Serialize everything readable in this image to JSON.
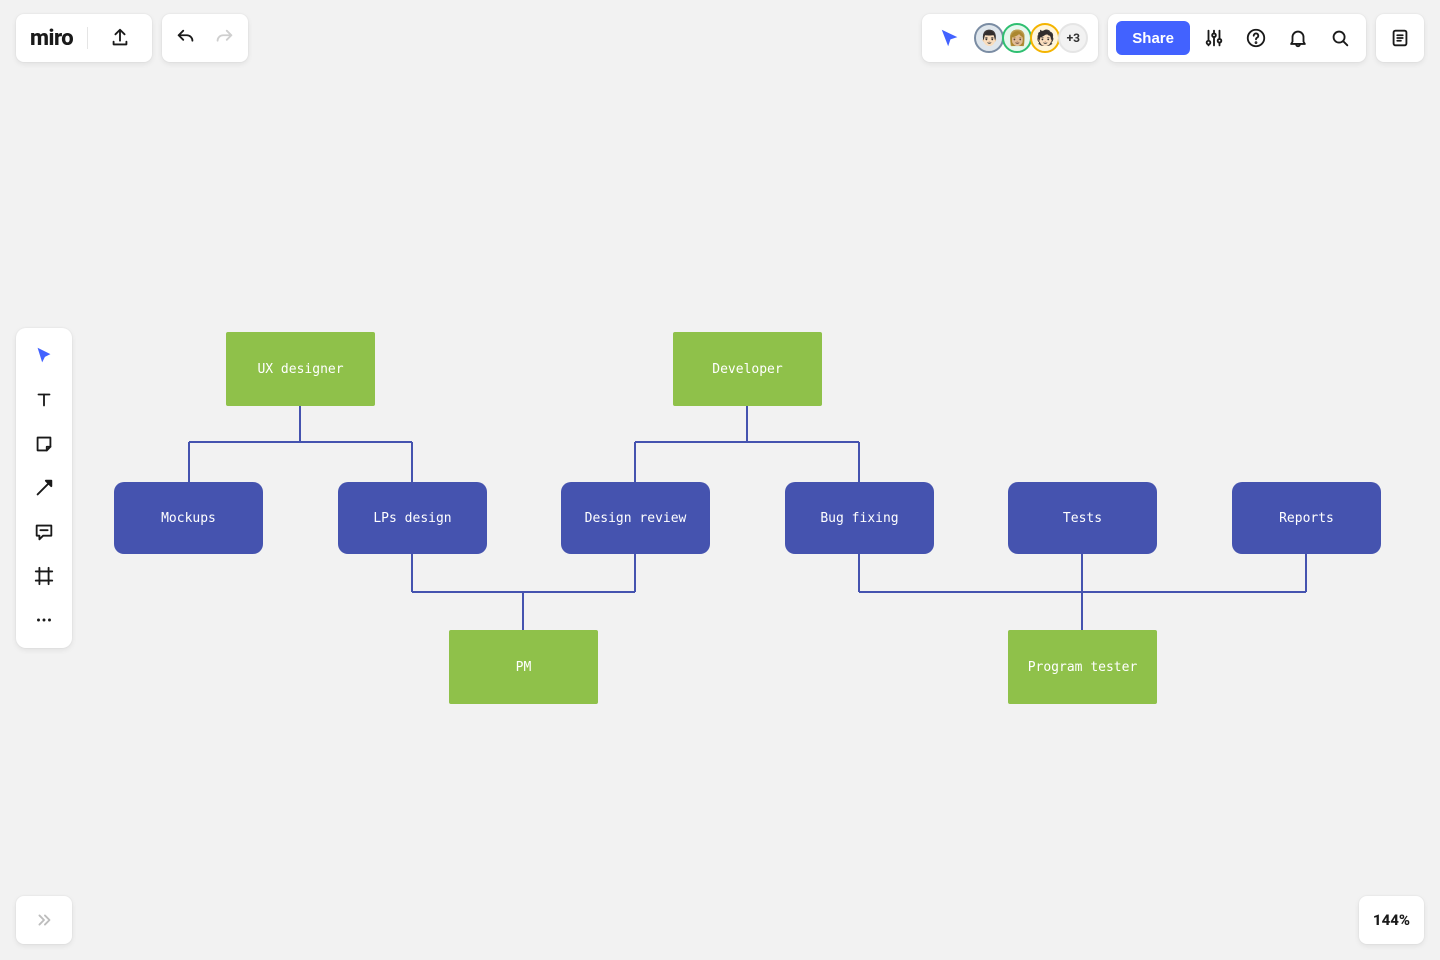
{
  "app": {
    "name": "miro"
  },
  "header": {
    "share_label": "Share",
    "overflow_count": "+3"
  },
  "collaborators": [
    {
      "color": "#7a8ca3",
      "emoji": "👨🏻"
    },
    {
      "color": "#2fbf71",
      "emoji": "👩🏼"
    },
    {
      "color": "#f4b400",
      "emoji": "🧑🏻"
    }
  ],
  "zoom": {
    "label": "144%"
  },
  "diagram": {
    "roles": {
      "ux_designer": "UX designer",
      "developer": "Developer",
      "pm": "PM",
      "program_tester": "Program tester"
    },
    "tasks": {
      "mockups": "Mockups",
      "lps_design": "LPs design",
      "design_review": "Design review",
      "bug_fixing": "Bug fixing",
      "tests": "Tests",
      "reports": "Reports"
    },
    "structure": {
      "UX designer": [
        "Mockups",
        "LPs design"
      ],
      "Developer": [
        "Design review",
        "Bug fixing"
      ],
      "PM": [
        "LPs design",
        "Design review"
      ],
      "Program tester": [
        "Bug fixing",
        "Tests",
        "Reports"
      ]
    }
  },
  "colors": {
    "role_node": "#8fc14a",
    "task_node": "#4553af",
    "connector": "#4553af",
    "accent": "#4262ff"
  }
}
